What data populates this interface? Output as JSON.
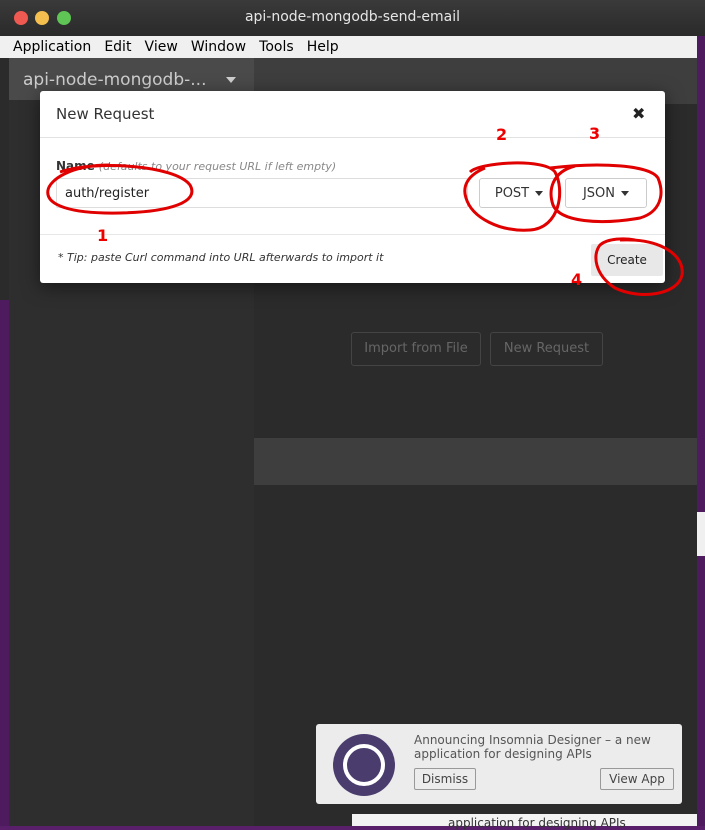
{
  "window": {
    "title": "api-node-mongodb-send-email"
  },
  "menu": {
    "items": [
      "Application",
      "Edit",
      "View",
      "Window",
      "Tools",
      "Help"
    ]
  },
  "sidebar": {
    "workspace": "api-node-mongodb-..."
  },
  "main": {
    "import_button": "Import from File",
    "new_request_button": "New Request"
  },
  "modal": {
    "title": "New Request",
    "close_glyph": "✖",
    "name_label": "Name",
    "name_hint": "(defaults to your request URL if left empty)",
    "name_value": "auth/register",
    "method": "POST",
    "body_type": "JSON",
    "tip": "* Tip: paste Curl command into URL afterwards to import it",
    "create_button": "Create"
  },
  "annotations": {
    "a1": "1",
    "a2": "2",
    "a3": "3",
    "a4": "4",
    "color": "#e00000"
  },
  "toast": {
    "text": "Announcing Insomnia Designer – a new application for designing APIs",
    "dismiss": "Dismiss",
    "view_app": "View App"
  },
  "footer": {
    "text": "application for designing APIs"
  }
}
